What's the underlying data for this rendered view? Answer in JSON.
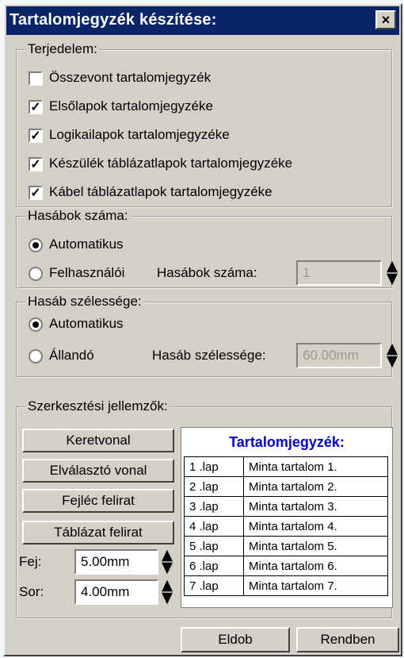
{
  "dialog": {
    "title": "Tartalomjegyzék készítése:",
    "close_label": "×"
  },
  "scope": {
    "legend": "Terjedelem:",
    "options": [
      {
        "label": "Összevont tartalomjegyzék",
        "checked": false,
        "mark": ""
      },
      {
        "label": "Elsőlapok tartalomjegyzéke",
        "checked": true,
        "mark": "✓"
      },
      {
        "label": "Logikailapok tartalomjegyzéke",
        "checked": true,
        "mark": "✓"
      },
      {
        "label": "Készülék táblázatlapok tartalomjegyzéke",
        "checked": true,
        "mark": "✓"
      },
      {
        "label": "Kábel táblázatlapok tartalomjegyzéke",
        "checked": true,
        "mark": "✓"
      }
    ]
  },
  "columns": {
    "legend": "Hasábok száma:",
    "auto_label": "Automatikus",
    "user_label": "Felhasználói",
    "count_label": "Hasábok száma:",
    "count_value": "1",
    "selected": "auto"
  },
  "column_width": {
    "legend": "Hasáb szélessége:",
    "auto_label": "Automatikus",
    "fixed_label": "Állandó",
    "width_label": "Hasáb szélessége:",
    "width_value": "60.00mm",
    "selected": "auto"
  },
  "edit": {
    "legend": "Szerkesztési jellemzők:",
    "buttons": {
      "frame": "Keretvonal",
      "separator": "Elválasztó vonal",
      "header_text": "Fejléc felirat",
      "table_text": "Táblázat felirat"
    },
    "header_label": "Fej:",
    "header_value": "5.00mm",
    "row_label": "Sor:",
    "row_value": "4.00mm"
  },
  "preview": {
    "title": "Tartalomjegyzék:",
    "rows": [
      {
        "page": "1 .lap",
        "content": "Minta tartalom 1."
      },
      {
        "page": "2 .lap",
        "content": "Minta tartalom 2."
      },
      {
        "page": "3 .lap",
        "content": "Minta tartalom 3."
      },
      {
        "page": "4 .lap",
        "content": "Minta tartalom 4."
      },
      {
        "page": "5 .lap",
        "content": "Minta tartalom 5."
      },
      {
        "page": "6 .lap",
        "content": "Minta tartalom 6."
      },
      {
        "page": "7 .lap",
        "content": "Minta tartalom 7."
      }
    ]
  },
  "footer": {
    "discard_label": "Eldob",
    "ok_label": "Rendben"
  },
  "colors": {
    "titlebar": "#0a246a",
    "dialog_bg": "#d4d0c8",
    "preview_title": "#0000c8"
  }
}
